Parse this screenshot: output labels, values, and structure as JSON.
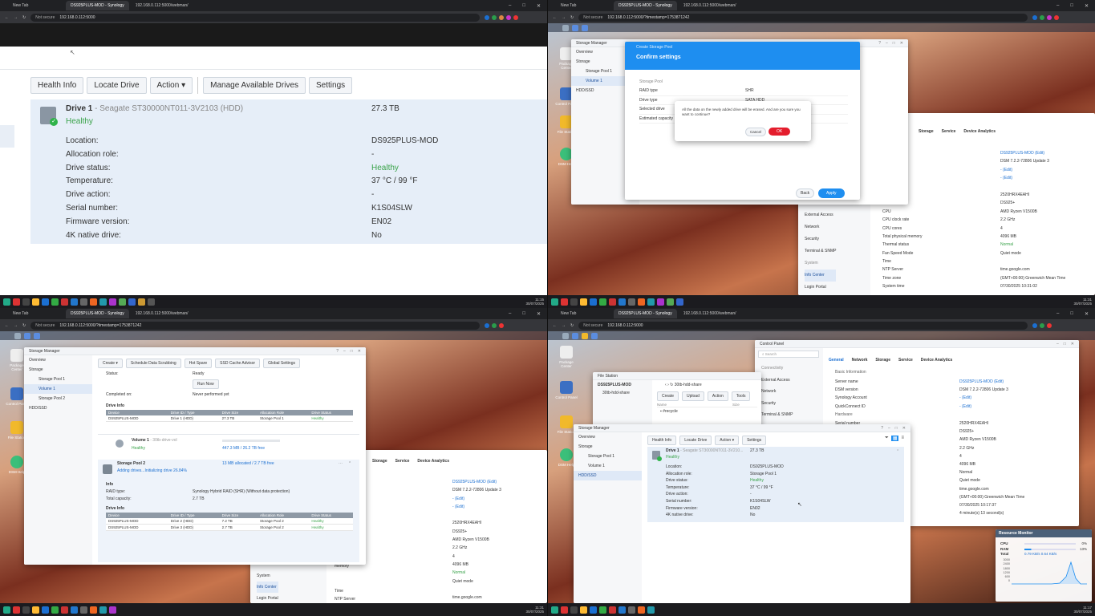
{
  "q1": {
    "tabs": [
      "New Tab",
      "DS925PLUS-MOD - Synology",
      "192.168.0.112:5000/webman/"
    ],
    "url_ns": "Not secure",
    "url": "192.168.0.112:5000",
    "toolbar": [
      "Health Info",
      "Locate Drive",
      "Action",
      "Manage Available Drives",
      "Settings"
    ],
    "drive": {
      "name": "Drive 1",
      "model": " - Seagate ST30000NT011-3V2103 (HDD)",
      "size": "27.3 TB",
      "status": "Healthy"
    },
    "rows": [
      {
        "k": "Location:",
        "v": "DS925PLUS-MOD"
      },
      {
        "k": "Allocation role:",
        "v": "-"
      },
      {
        "k": "Drive status:",
        "v": "Healthy"
      },
      {
        "k": "Temperature:",
        "v": "37 °C / 99 °F"
      },
      {
        "k": "Drive action:",
        "v": "-"
      },
      {
        "k": "Serial number:",
        "v": "K1S04SLW"
      },
      {
        "k": "Firmware version:",
        "v": "EN02"
      },
      {
        "k": "4K native drive:",
        "v": "No"
      }
    ],
    "time": "11:15",
    "date": "30/07/2025"
  },
  "q2": {
    "tabs": [
      "New Tab",
      "DS925PLUS-MOD - Synology",
      "192.168.0.112:5000/webman/"
    ],
    "url_ns": "Not secure",
    "url": "192.168.0.112:5000/?timestamp=1753871242",
    "sm_title": "Storage Manager",
    "sm_side": [
      "Overview",
      "Storage",
      "Storage Pool 1",
      "Volume 1",
      "HDD/SSD"
    ],
    "csp_title": "Create Storage Pool",
    "confirm_title": "Confirm settings",
    "section": "Storage Pool",
    "cfg": [
      {
        "k": "RAID type",
        "v": "SHR"
      },
      {
        "k": "Drive type",
        "v": "SATA HDD"
      },
      {
        "k": "Selected drive",
        "v": ""
      },
      {
        "k": "Estimated capacity",
        "v": ""
      }
    ],
    "dialog_msg": "All the data on the newly added drive will be erased. And are you sure you want to continue?",
    "cancel": "Cancel",
    "ok": "OK",
    "back": "Back",
    "apply": "Apply",
    "cp_tabs": [
      "Storage",
      "Service",
      "Device Analytics"
    ],
    "cp_side": [
      "External Access",
      "Network",
      "Security",
      "Terminal & SNMP",
      "System",
      "Info Center",
      "Login Portal"
    ],
    "info": [
      "DS925PLUS-MOD (Edit)",
      "DSM 7.2.2-72806 Update 3",
      "- (Edit)",
      "- (Edit)",
      "",
      "2520HRX4EAHI",
      "DS925+",
      "AMD Ryzen V1500B",
      "2.2 GHz",
      "4",
      "4096 MB",
      "Normal",
      "Quiet mode",
      "",
      "time.google.com",
      "(GMT+00:00) Greenwich Mean Time",
      "07/30/2025 10:31:02"
    ],
    "info_keys": [
      "",
      "",
      "",
      "",
      "",
      "",
      "",
      "CPU",
      "CPU clock rate",
      "CPU cores",
      "Total physical memory",
      "Thermal status",
      "Fan Speed Mode",
      "Time",
      "NTP Server",
      "Time zone",
      "System time"
    ],
    "desk_icons": [
      "Package Center",
      "Control Panel",
      "File Station",
      "DSM Help"
    ],
    "time": "11:31",
    "date": "30/07/2025"
  },
  "q3": {
    "tabs": [
      "New Tab",
      "DS925PLUS-MOD - Synology",
      "192.168.0.112:5000/webman/"
    ],
    "url_ns": "Not secure",
    "url": "192.168.0.112:5000/?timestamp=1753871242",
    "sm_title": "Storage Manager",
    "sm_side": [
      "Overview",
      "Storage",
      "Storage Pool 1",
      "Volume 1",
      "Storage Pool 2",
      "HDD/SSD"
    ],
    "tb": [
      "Create",
      "Schedule Data Scrubbing",
      "Hot Spare",
      "SSD Cache Advisor",
      "Global Settings"
    ],
    "status_k": "Status:",
    "status_v": "Ready",
    "run_now": "Run Now",
    "completed_k": "Completed on:",
    "completed_v": "Never performed yet",
    "drive_info": "Drive Info",
    "cols": [
      "Device",
      "Drive ID / Type",
      "Drive Size",
      "Allocation Role",
      "Drive Status"
    ],
    "pool1_rows": [
      [
        "DS925PLUS-MOD",
        "Drive 1 (HDD)",
        "27.3 TB",
        "Storage Pool 1",
        "Healthy"
      ]
    ],
    "vol1": {
      "name": "Volume 1",
      "sub": "- 30tb-drive-vol",
      "status": "Healthy",
      "usage": "447.3 MB / 26.2 TB free"
    },
    "pool2": {
      "name": "Storage Pool 2",
      "status": "Adding drives...Initializing drive 26.84%",
      "alloc": "13 MB allocated / 2.7 TB free"
    },
    "info": "Info",
    "raid_k": "RAID type:",
    "raid_v": "Synology Hybrid RAID (SHR) (Without data protection)",
    "cap_k": "Total capacity:",
    "cap_v": "2.7 TB",
    "pool2_rows": [
      [
        "DS925PLUS-MOD",
        "Drive 2 (HDD)",
        "7.2 TB",
        "Storage Pool 2",
        "Healthy"
      ],
      [
        "DS925PLUS-MOD",
        "Drive 3 (HDD)",
        "2.7 TB",
        "Storage Pool 2",
        "Healthy"
      ]
    ],
    "cp_tabs": [
      "Storage",
      "Service",
      "Device Analytics"
    ],
    "info_vals": [
      "DS925PLUS-MOD (Edit)",
      "DSM 7.2.2-72806 Update 3",
      "- (Edit)",
      "- (Edit)",
      "",
      "2520HRX4EAHI",
      "DS925+",
      "AMD Ryzen V1500B",
      "2.2 GHz",
      "4",
      "4096 MB",
      "Normal",
      "Quiet mode",
      "",
      "time.google.com",
      "(GMT+00:00) Greenwich Mean Time",
      "07/30/2025 10:31:43"
    ],
    "cp_side": [
      "System",
      "Info Center",
      "Login Portal"
    ],
    "info_keys": [
      "memory",
      "",
      "",
      "Time",
      "NTP Server",
      "Time zone",
      "System time"
    ],
    "desk_icons": [
      "Package Center",
      "Control Panel",
      "File Station",
      "DSM Help"
    ],
    "time": "11:31",
    "date": "30/07/2025"
  },
  "q4": {
    "tabs": [
      "New Tab",
      "DS925PLUS-MOD - Synology",
      "192.168.0.112:5000/webman/"
    ],
    "url_ns": "Not secure",
    "url": "192.168.0.112:5000",
    "cp_title": "Control Panel",
    "search": "Search",
    "cp_tabs": [
      "General",
      "Network",
      "Storage",
      "Service",
      "Device Analytics"
    ],
    "cp_side": [
      "Connectivity",
      "External Access",
      "Network",
      "Security",
      "Terminal & SNMP"
    ],
    "basic": "Basic Information",
    "basic_rows": [
      {
        "k": "Server name",
        "v": "DS925PLUS-MOD (Edit)"
      },
      {
        "k": "DSM version",
        "v": "DSM 7.2.2-72806 Update 3"
      },
      {
        "k": "Synology Account",
        "v": "- (Edit)"
      },
      {
        "k": "QuickConnect ID",
        "v": "- (Edit)"
      }
    ],
    "hardware": "Hardware",
    "hw_rows": [
      {
        "k": "Serial number",
        "v": "2520HRX4EAHI"
      },
      {
        "k": "",
        "v": "DS925+"
      },
      {
        "k": "",
        "v": "AMD Ryzen V1500B"
      },
      {
        "k": "",
        "v": "2.2 GHz"
      },
      {
        "k": "",
        "v": "4"
      },
      {
        "k": "",
        "v": "4096 MB"
      },
      {
        "k": "",
        "v": "Normal"
      },
      {
        "k": "",
        "v": "Quiet mode"
      },
      {
        "k": "",
        "v": ""
      },
      {
        "k": "",
        "v": "time.google.com"
      },
      {
        "k": "",
        "v": "(GMT+00:00) Greenwich Mean Time"
      },
      {
        "k": "",
        "v": "07/30/2025 10:17:37"
      },
      {
        "k": "",
        "v": "4 minute(s) 13 second(s)"
      }
    ],
    "fs_title": "File Station",
    "fs_path": "30tb-hdd-share",
    "fs_tree": "DS925PLUS-MOD",
    "fs_sub": "30tb-hdd-share",
    "fs_btns": [
      "Create",
      "Upload",
      "Action",
      "Tools"
    ],
    "fs_item": "#recycle",
    "fs_cols": [
      "Name",
      "Size"
    ],
    "sm_title": "Storage Manager",
    "sm_side": [
      "Overview",
      "Storage",
      "Storage Pool 1",
      "Volume 1",
      "HDD/SSD"
    ],
    "sm_tb": [
      "Health Info",
      "Locate Drive",
      "Action",
      "Settings"
    ],
    "drive": {
      "name": "Drive 1",
      "model": "- Seagate ST30000NT011-3V210...",
      "size": "27.3 TB",
      "status": "Healthy"
    },
    "rows": [
      {
        "k": "Location:",
        "v": "DS925PLUS-MOD"
      },
      {
        "k": "Allocation role:",
        "v": "Storage Pool 1"
      },
      {
        "k": "Drive status:",
        "v": "Healthy"
      },
      {
        "k": "Temperature:",
        "v": "37 °C / 99 °F"
      },
      {
        "k": "Drive action:",
        "v": "-"
      },
      {
        "k": "Serial number:",
        "v": "K1S04SLW"
      },
      {
        "k": "Firmware version:",
        "v": "EN02"
      },
      {
        "k": "4K native drive:",
        "v": "No"
      }
    ],
    "rm_title": "Resource Monitor",
    "rm": [
      {
        "k": "CPU",
        "v": "0%"
      },
      {
        "k": "RAM",
        "v": "13%"
      },
      {
        "k": "Total",
        "v": "0.79 KB/s  0.64 KB/s"
      }
    ],
    "rm_chart": {
      "y_ticks": [
        "3000",
        "2400",
        "1800",
        "1200",
        "600",
        "0"
      ]
    },
    "desk_icons": [
      "Package Center",
      "Control Panel",
      "File Station",
      "DSM Help"
    ],
    "time": "11:17",
    "date": "30/07/2025"
  }
}
